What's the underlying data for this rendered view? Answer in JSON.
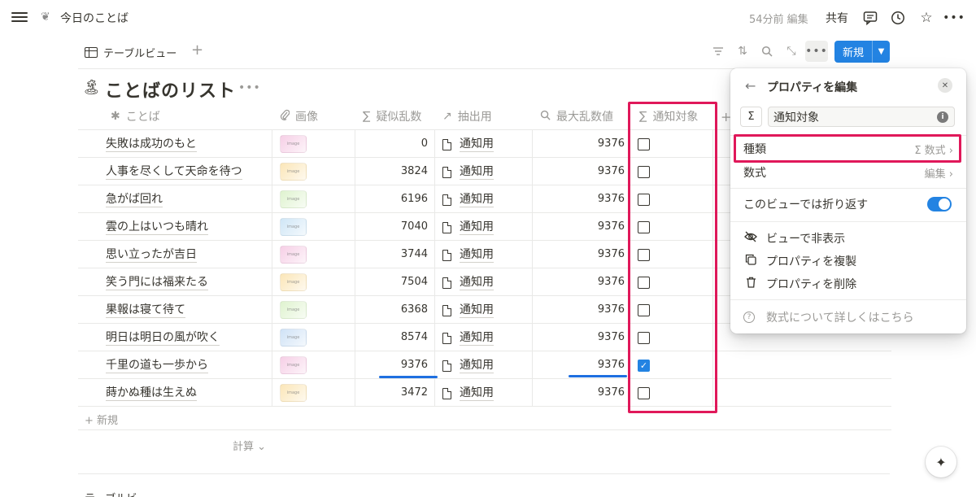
{
  "topbar": {
    "page_title": "今日のことば",
    "edited": "54分前 編集",
    "share": "共有",
    "icons": [
      "menu-icon",
      "page-leaf-icon",
      "comment-icon",
      "history-clock-icon",
      "star-icon",
      "more-dots-icon"
    ]
  },
  "view": {
    "tab_label": "テーブルビュー",
    "add": "+",
    "new_button": "新規",
    "more": "•••",
    "tools": [
      "filter-icon",
      "sort-icon",
      "search-icon",
      "expand-icon"
    ]
  },
  "database": {
    "emoji": "🏝",
    "title": "ことばのリスト",
    "more": "•••"
  },
  "table": {
    "columns": [
      {
        "label": "ことば",
        "icon": "✱"
      },
      {
        "label": "画像",
        "icon": "⌕"
      },
      {
        "label": "疑似乱数",
        "icon": "∑"
      },
      {
        "label": "抽出用",
        "icon": "↗"
      },
      {
        "label": "最大乱数値",
        "icon": "⌕"
      },
      {
        "label": "通知対象",
        "icon": "∑"
      }
    ],
    "add_column": "+",
    "image_placeholder": "image",
    "rows": [
      {
        "name": "失敗は成功のもと",
        "rand": "0",
        "rel": "通知用",
        "max": "9376",
        "checked": false,
        "img": "#f6cfe6"
      },
      {
        "name": "人事を尽くして天命を待つ",
        "rand": "3824",
        "rel": "通知用",
        "max": "9376",
        "checked": false,
        "img": "#fbe6b8"
      },
      {
        "name": "急がば回れ",
        "rand": "6196",
        "rel": "通知用",
        "max": "9376",
        "checked": false,
        "img": "#dff3cf"
      },
      {
        "name": "雲の上はいつも晴れ",
        "rand": "7040",
        "rel": "通知用",
        "max": "9376",
        "checked": false,
        "img": "#cfe6f6"
      },
      {
        "name": "思い立ったが吉日",
        "rand": "3744",
        "rel": "通知用",
        "max": "9376",
        "checked": false,
        "img": "#f6cfe6"
      },
      {
        "name": "笑う門には福来たる",
        "rand": "7504",
        "rel": "通知用",
        "max": "9376",
        "checked": false,
        "img": "#fbe6b8"
      },
      {
        "name": "果報は寝て待て",
        "rand": "6368",
        "rel": "通知用",
        "max": "9376",
        "checked": false,
        "img": "#dff3cf"
      },
      {
        "name": "明日は明日の風が吹く",
        "rand": "8574",
        "rel": "通知用",
        "max": "9376",
        "checked": false,
        "img": "#cfe2f6"
      },
      {
        "name": "千里の道も一歩から",
        "rand": "9376",
        "rel": "通知用",
        "max": "9376",
        "checked": true,
        "img": "#f6cfe6"
      },
      {
        "name": "蒔かぬ種は生えぬ",
        "rand": "3472",
        "rel": "通知用",
        "max": "9376",
        "checked": false,
        "img": "#fbe6b8"
      }
    ],
    "add_row": "+ 新規",
    "calc": "計算 ⌄"
  },
  "popup": {
    "title": "プロパティを編集",
    "back": "←",
    "close": "✕",
    "sigma": "Σ",
    "name_value": "通知対象",
    "info": "i",
    "type_label": "種類",
    "type_value": "Σ 数式 ›",
    "formula_label": "数式",
    "formula_value": "編集 ›",
    "wrap_label": "このビューでは折り返す",
    "wrap_on": true,
    "hide_label": "ビューで非表示",
    "duplicate_label": "プロパティを複製",
    "delete_label": "プロパティを削除",
    "help_label": "数式について詳しくはこちら"
  },
  "next_view_label": "テーブルビ",
  "colors": {
    "accent": "#2383e2",
    "highlight_red": "#e0185a",
    "underline_blue": "#1e6fe0"
  }
}
